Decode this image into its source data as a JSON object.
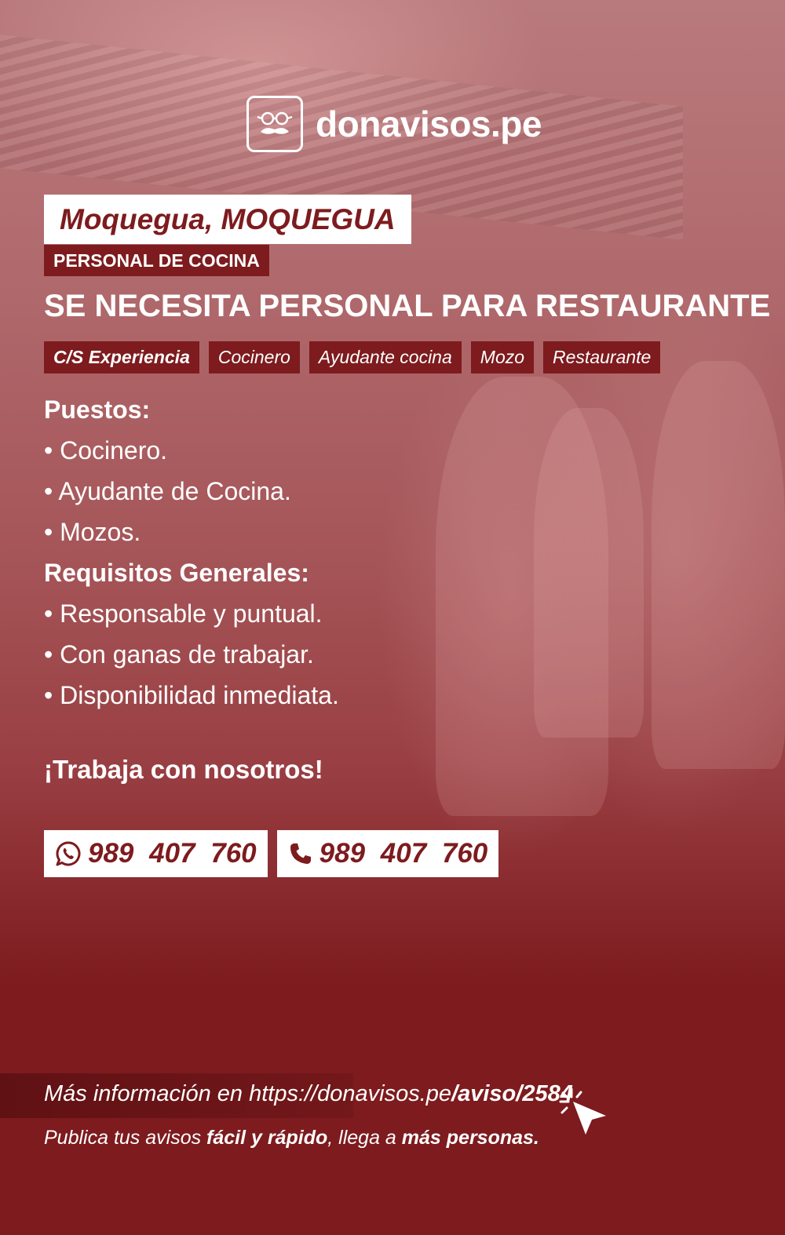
{
  "brand": {
    "name": "donavisos.pe",
    "logo_icon": "glasses-mustache-icon"
  },
  "location": "Moquegua, MOQUEGUA",
  "category": "PERSONAL DE COCINA",
  "headline": "SE NECESITA PERSONAL PARA RESTAURANTE",
  "tags": [
    "C/S Experiencia",
    "Cocinero",
    "Ayudante cocina",
    "Mozo",
    "Restaurante"
  ],
  "sections": {
    "positions": {
      "title": "Puestos:",
      "items": [
        "• Cocinero.",
        "• Ayudante de Cocina.",
        "• Mozos."
      ]
    },
    "requirements": {
      "title": "Requisitos Generales:",
      "items": [
        "• Responsable y puntual.",
        "• Con ganas de trabajar.",
        "• Disponibilidad inmediata."
      ]
    }
  },
  "cta": "¡Trabaja con nosotros!",
  "contacts": {
    "whatsapp": {
      "icon": "whatsapp-icon",
      "number": "989 407 760"
    },
    "phone": {
      "icon": "phone-icon",
      "number": "989 407 760"
    }
  },
  "footer": {
    "more_info_prefix": "Más información en https://donavisos.pe",
    "more_info_path": "/aviso/2584",
    "publish_1": "Publica tus avisos ",
    "publish_2": "fácil y rápido",
    "publish_3": ", llega a ",
    "publish_4": "más personas."
  },
  "colors": {
    "brand_red": "#7d1b1e",
    "text": "#ffffff"
  }
}
